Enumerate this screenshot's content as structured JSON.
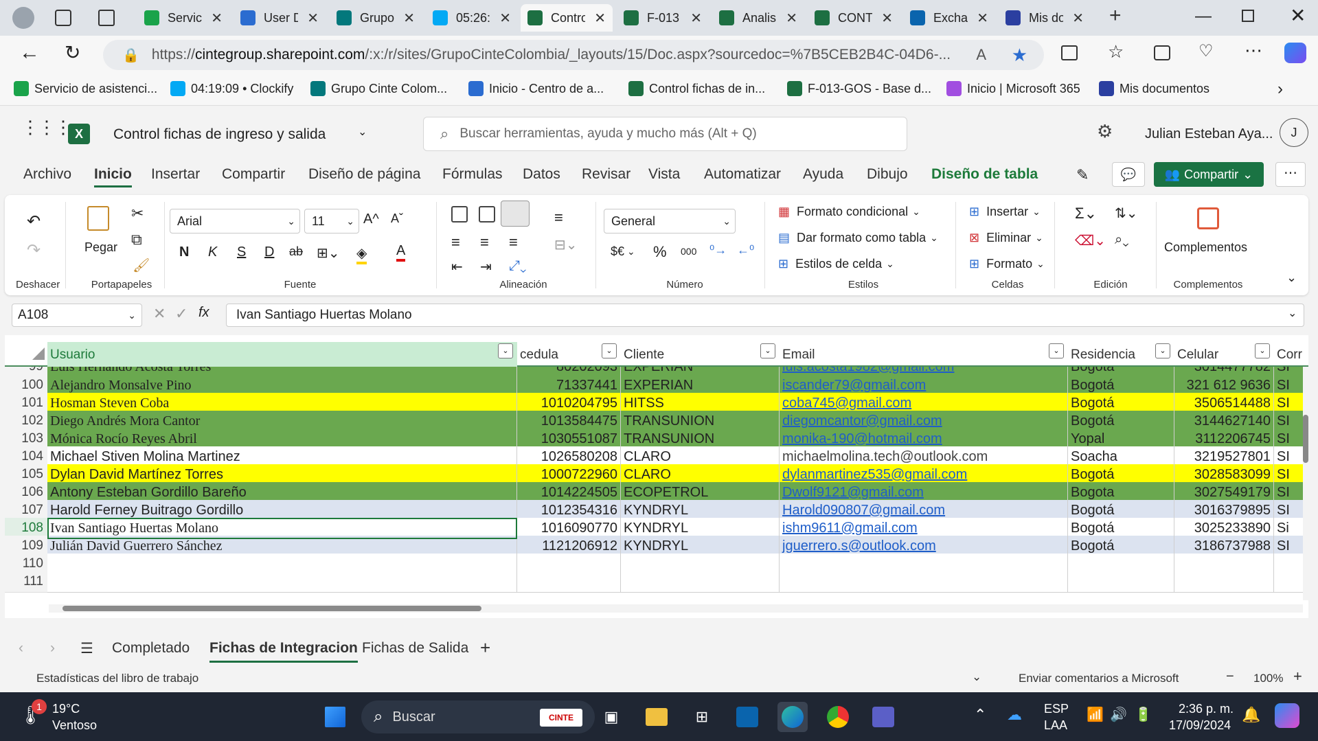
{
  "browser": {
    "tabs": [
      {
        "label": "Servici",
        "icon": "headset-icon",
        "color": "#1aa34a"
      },
      {
        "label": "User D",
        "icon": "azure-icon",
        "color": "#2b6cd0"
      },
      {
        "label": "Grupo",
        "icon": "sharepoint-icon",
        "color": "#03787c"
      },
      {
        "label": "05:26:",
        "icon": "clockify-icon",
        "color": "#03a9f4"
      },
      {
        "label": "Contro",
        "icon": "excel-icon",
        "color": "#1d6f42"
      },
      {
        "label": "F-013",
        "icon": "excel-icon",
        "color": "#1d6f42"
      },
      {
        "label": "Analis",
        "icon": "excel-icon",
        "color": "#1d6f42"
      },
      {
        "label": "CONT",
        "icon": "excel-icon",
        "color": "#1d6f42"
      },
      {
        "label": "Exchar",
        "icon": "exchange-icon",
        "color": "#0a64ad"
      },
      {
        "label": "Mis do",
        "icon": "app-icon",
        "color": "#2b3fa0"
      }
    ],
    "url_prefix": "https://",
    "url_host": "cintegroup.sharepoint.com",
    "url_path": "/:x:/r/sites/GrupoCinteColombia/_layouts/15/Doc.aspx?sourcedoc=%7B5CEB2B4C-04D6-...",
    "bookmarks": [
      {
        "label": "Servicio de asistenci...",
        "color": "#1aa34a"
      },
      {
        "label": "04:19:09 • Clockify",
        "color": "#03a9f4"
      },
      {
        "label": "Grupo Cinte Colom...",
        "color": "#03787c"
      },
      {
        "label": "Inicio - Centro de a...",
        "color": "#2b6cd0"
      },
      {
        "label": "Control fichas de in...",
        "color": "#1d6f42"
      },
      {
        "label": "F-013-GOS - Base d...",
        "color": "#1d6f42"
      },
      {
        "label": "Inicio | Microsoft 365",
        "color": "#a14ee0"
      },
      {
        "label": "Mis documentos",
        "color": "#2b3fa0"
      }
    ]
  },
  "excel": {
    "doc_title": "Control fichas de ingreso y salida",
    "search_placeholder": "Buscar herramientas, ayuda y mucho más (Alt + Q)",
    "user_name": "Julian Esteban Aya...",
    "user_initial": "J",
    "menu": [
      "Archivo",
      "Inicio",
      "Insertar",
      "Compartir",
      "Diseño de página",
      "Fórmulas",
      "Datos",
      "Revisar",
      "Vista",
      "Automatizar",
      "Ayuda",
      "Dibujo",
      "Diseño de tabla"
    ],
    "share_label": "Compartir",
    "ribbon": {
      "undo_group": "Deshacer",
      "paste": "Pegar",
      "clipboard_group": "Portapapeles",
      "font_name": "Arial",
      "font_size": "11",
      "font_group": "Fuente",
      "bold": "N",
      "italic": "K",
      "strike": "S",
      "underline": "D",
      "align_group": "Alineación",
      "number_format": "General",
      "currency": "$€",
      "percent": "%",
      "thousands": "000",
      "number_group": "Número",
      "cond_format": "Formato condicional",
      "format_table": "Dar formato como tabla",
      "cell_styles": "Estilos de celda",
      "styles_group": "Estilos",
      "insert": "Insertar",
      "delete": "Eliminar",
      "format": "Formato",
      "cells_group": "Celdas",
      "editing_group": "Edición",
      "addins": "Complementos",
      "addins_group": "Complementos"
    },
    "name_box": "A108",
    "formula": "Ivan Santiago Huertas Molano",
    "columns": [
      "Usuario",
      "cedula",
      "Cliente",
      "Email",
      "Residencia",
      "Celular",
      "Corr"
    ],
    "partial_row": {
      "rownum": "99",
      "name": "Luis Hernando Acosta Torres",
      "cedula": "80202093",
      "cliente": "EXPERIAN",
      "email": "luis.acosta1982@gmail.com",
      "res": "Bogotá",
      "cel": "3014477782",
      "corr": "SI"
    },
    "rows": [
      {
        "rownum": "100",
        "name": "Alejandro Monsalve Pino",
        "cedula": "71337441",
        "cliente": "EXPERIAN",
        "email": "iscander79@gmail.com",
        "res": "Bogotá",
        "cel": "321 612 9636",
        "corr": "SI",
        "fill": "#6aa84f",
        "serif": true
      },
      {
        "rownum": "101",
        "name": "Hosman Steven Coba",
        "cedula": "1010204795",
        "cliente": "HITSS",
        "email": "coba745@gmail.com",
        "res": "Bogotá",
        "cel": "3506514488",
        "corr": "SI",
        "fill": "#ffff00",
        "serif": true
      },
      {
        "rownum": "102",
        "name": "Diego Andrés Mora Cantor",
        "cedula": "1013584475",
        "cliente": "TRANSUNION",
        "email": "diegomcantor@gmail.com",
        "res": "Bogotá",
        "cel": "3144627140",
        "corr": "SI",
        "fill": "#6aa84f",
        "serif": true
      },
      {
        "rownum": "103",
        "name": "Mónica Rocío Reyes Abril",
        "cedula": "1030551087",
        "cliente": "TRANSUNION",
        "email": "monika-190@hotmail.com",
        "res": "Yopal",
        "cel": "3112206745",
        "corr": "SI",
        "fill": "#6aa84f",
        "serif": true
      },
      {
        "rownum": "104",
        "name": "Michael Stiven Molina Martinez",
        "cedula": "1026580208",
        "cliente": "CLARO",
        "email": "michaelmolina.tech@outlook.com",
        "res": "Soacha",
        "cel": "3219527801",
        "corr": "SI",
        "fill": "#ffffff",
        "serif": false,
        "plainEmail": true
      },
      {
        "rownum": "105",
        "name": "Dylan David Martínez Torres",
        "cedula": "1000722960",
        "cliente": "CLARO",
        "email": "dylanmartinez535@gmail.com",
        "res": "Bogotá",
        "cel": "3028583099",
        "corr": "SI",
        "fill": "#ffff00",
        "serif": false
      },
      {
        "rownum": "106",
        "name": "Antony Esteban Gordillo Bareño",
        "cedula": "1014224505",
        "cliente": "ECOPETROL",
        "email": "Dwolf9121@gmail.com",
        "res": "Bogota",
        "cel": "3027549179",
        "corr": "SI",
        "fill": "#6aa84f",
        "serif": false
      },
      {
        "rownum": "107",
        "name": "Harold Ferney Buitrago Gordillo",
        "cedula": "1012354316",
        "cliente": "KYNDRYL",
        "email": "Harold090807@gmail.com",
        "res": "Bogotá",
        "cel": "3016379895",
        "corr": "SI",
        "fill": "#dce3f0",
        "serif": false
      },
      {
        "rownum": "108",
        "name": "Ivan Santiago Huertas Molano",
        "cedula": "1016090770",
        "cliente": "KYNDRYL",
        "email": "ishm9611@gmail.com",
        "res": "Bogotá",
        "cel": "3025233890",
        "corr": "Si",
        "fill": "#ffffff",
        "serif": true
      },
      {
        "rownum": "109",
        "name": "Julián David Guerrero Sánchez",
        "cedula": "1121206912",
        "cliente": "KYNDRYL",
        "email": "jguerrero.s@outlook.com",
        "res": "Bogotá",
        "cel": "3186737988",
        "corr": "SI",
        "fill": "#dce3f0",
        "serif": true
      }
    ],
    "empty_rows": [
      "110",
      "111"
    ],
    "sheets": [
      "Completado",
      "Fichas de Integracion",
      "Fichas de Salida"
    ],
    "active_sheet": "Fichas de Integracion",
    "status_left": "Estadísticas del libro de trabajo",
    "feedback": "Enviar comentarios a Microsoft",
    "zoom": "100%"
  },
  "taskbar": {
    "weather_temp": "19°C",
    "weather_desc": "Ventoso",
    "weather_badge": "1",
    "search": "Buscar",
    "lang1": "ESP",
    "lang2": "LAA",
    "time": "2:36 p. m.",
    "date": "17/09/2024"
  }
}
